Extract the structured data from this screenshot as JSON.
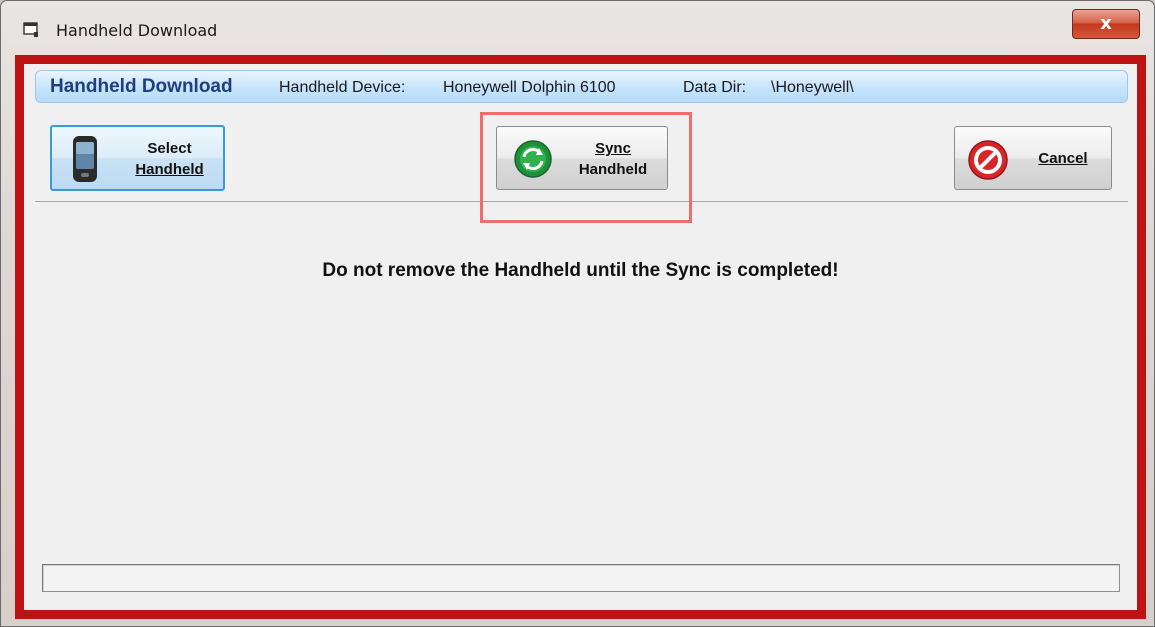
{
  "window": {
    "title": "Handheld Download",
    "close_label": "x"
  },
  "header": {
    "title": "Handheld Download",
    "device_label": "Handheld Device:",
    "device_value": "Honeywell Dolphin 6100",
    "data_dir_label": "Data Dir:",
    "data_dir_value": "\\Honeywell\\"
  },
  "toolbar": {
    "select": {
      "line1": "Select",
      "line2": "Handheld",
      "icon": "handheld-phone-icon"
    },
    "sync": {
      "line1": "Sync",
      "line2": "Handheld",
      "icon": "sync-arrows-icon"
    },
    "cancel": {
      "label": "Cancel",
      "icon": "no-entry-icon"
    }
  },
  "message": "Do not remove the Handheld until the Sync is completed!",
  "progress": {
    "value": 0
  },
  "colors": {
    "frame_highlight": "#bd1313",
    "header_title": "#1f3f83",
    "sync_highlight": "#ec6f6c"
  }
}
